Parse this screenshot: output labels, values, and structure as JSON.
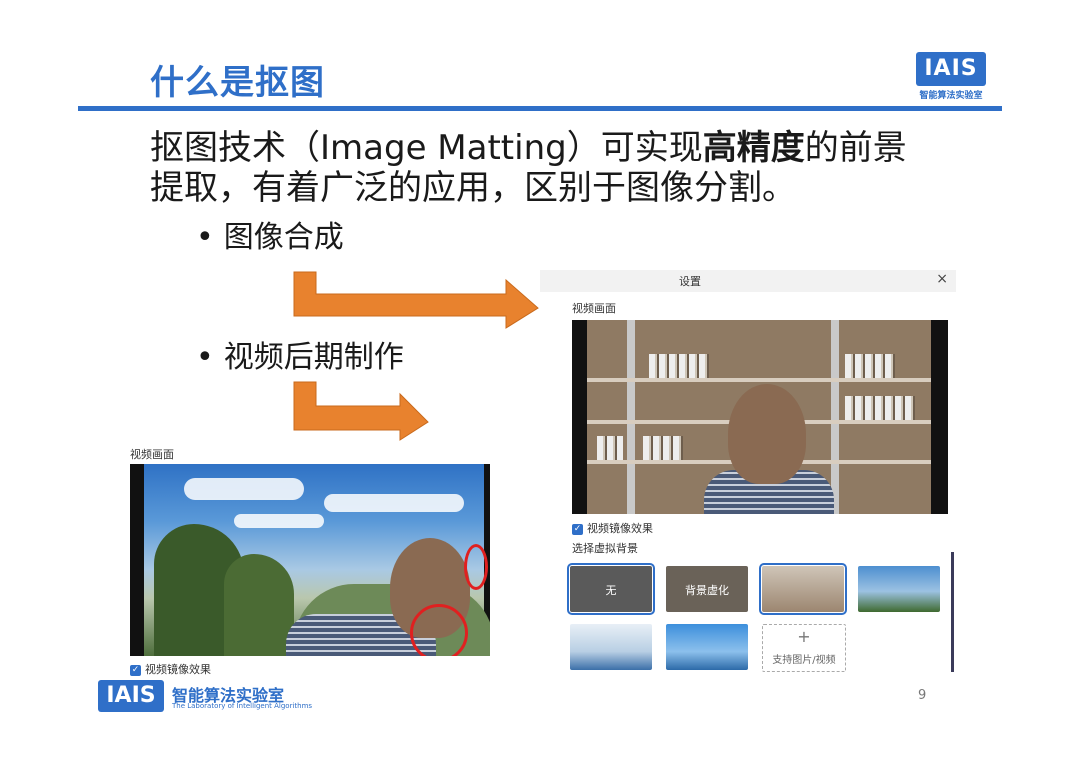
{
  "slide": {
    "title": "什么是抠图",
    "logo_mark": "IAIS",
    "logo_caption": "智能算法实验室",
    "headline_part1": "抠图技术（Image Matting）可实现",
    "headline_bold": "高精度",
    "headline_part2": "的前景提取，有着广泛的应用，区别于图像分割。",
    "bullets": [
      "图像合成",
      "视频后期制作"
    ],
    "bullet_glyph": "•",
    "page_number": "9"
  },
  "settings_window": {
    "title": "设置",
    "close_glyph": "×",
    "video_label": "视频画面",
    "mirror_label": "视频镜像效果",
    "bg_label": "选择虚拟背景",
    "tiles": [
      {
        "label": "无",
        "color": "#5a5a5a",
        "selected": true
      },
      {
        "label": "背景虚化",
        "color": "#6a6258",
        "selected": false
      },
      {
        "label": "",
        "color": "#9c8670",
        "selected": true
      },
      {
        "label": "",
        "color": "#4d8fd0",
        "selected": false
      },
      {
        "label": "",
        "color": "#b8cfe4",
        "selected": false
      },
      {
        "label": "",
        "color": "#3d8fdc",
        "selected": false
      }
    ],
    "add_tile_plus": "+",
    "add_tile_label": "支持图片/视频"
  },
  "left_panel": {
    "video_label": "视频画面",
    "mirror_label": "视频镜像效果"
  },
  "footer": {
    "logo_mark": "IAIS",
    "logo_name": "智能算法实验室",
    "logo_sub": "The Laboratory of Intelligent Algorithms"
  },
  "colors": {
    "accent": "#2f6fc8",
    "arrow": "#e8822e",
    "annotation": "#e02020"
  }
}
